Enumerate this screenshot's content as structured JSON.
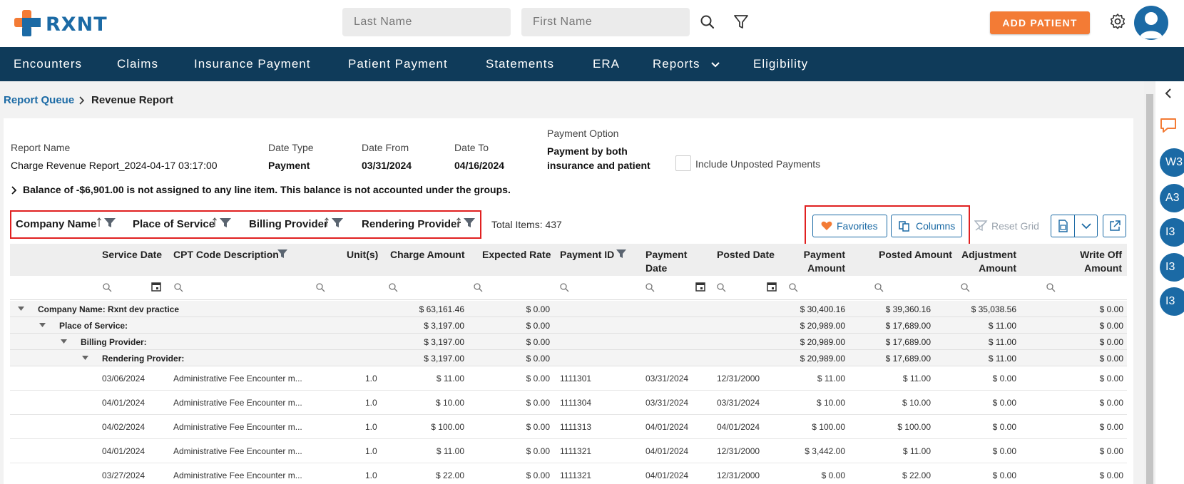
{
  "header": {
    "brand": "RXNT",
    "last_name_placeholder": "Last Name",
    "first_name_placeholder": "First Name",
    "add_patient_label": "ADD PATIENT"
  },
  "nav": {
    "items": [
      "Encounters",
      "Claims",
      "Insurance Payment",
      "Patient Payment",
      "Statements",
      "ERA",
      "Reports",
      "Eligibility"
    ]
  },
  "breadcrumb": {
    "parent": "Report Queue",
    "current": "Revenue Report"
  },
  "report": {
    "name_label": "Report Name",
    "name_value": "Charge Revenue Report_2024-04-17 03:17:00",
    "date_type_label": "Date Type",
    "date_type_value": "Payment",
    "date_from_label": "Date From",
    "date_from_value": "03/31/2024",
    "date_to_label": "Date To",
    "date_to_value": "04/16/2024",
    "payment_option_label": "Payment Option",
    "payment_option_value_line1": "Payment by both",
    "payment_option_value_line2": "insurance and patient",
    "include_unposted_label": "Include Unposted Payments",
    "balance_note": "Balance of -$6,901.00 is not assigned to any line item. This balance is not accounted under the groups."
  },
  "grouping": {
    "chips": [
      "Company Name",
      "Place of Service",
      "Billing Provider",
      "Rendering Provider"
    ],
    "total_items": "Total Items: 437"
  },
  "toolbar": {
    "favorites_label": "Favorites",
    "columns_label": "Columns",
    "reset_grid_label": "Reset Grid"
  },
  "table": {
    "headers": {
      "service_date": "Service Date",
      "cpt": "CPT Code Description",
      "units": "Unit(s)",
      "charge": "Charge Amount",
      "expected": "Expected Rate",
      "payment_id": "Payment ID",
      "payment_date_1": "Payment",
      "payment_date_2": "Date",
      "posted_date": "Posted Date",
      "payment_amount_1": "Payment",
      "payment_amount_2": "Amount",
      "posted_amount": "Posted Amount",
      "adjustment_1": "Adjustment",
      "adjustment_2": "Amount",
      "writeoff_1": "Write Off",
      "writeoff_2": "Amount"
    },
    "groups": [
      {
        "name": "Company Name: Rxnt dev practice",
        "charge": "$ 63,161.46",
        "expected": "$ 0.00",
        "payment": "$ 30,400.16",
        "posted": "$ 39,360.16",
        "adjustment": "$ 35,038.56",
        "writeoff": "$ 0.00"
      },
      {
        "name": "Place of Service:",
        "charge": "$ 3,197.00",
        "expected": "$ 0.00",
        "payment": "$ 20,989.00",
        "posted": "$ 17,689.00",
        "adjustment": "$ 11.00",
        "writeoff": "$ 0.00"
      },
      {
        "name": "Billing Provider:",
        "charge": "$ 3,197.00",
        "expected": "$ 0.00",
        "payment": "$ 20,989.00",
        "posted": "$ 17,689.00",
        "adjustment": "$ 11.00",
        "writeoff": "$ 0.00"
      },
      {
        "name": "Rendering Provider:",
        "charge": "$ 3,197.00",
        "expected": "$ 0.00",
        "payment": "$ 20,989.00",
        "posted": "$ 17,689.00",
        "adjustment": "$ 11.00",
        "writeoff": "$ 0.00"
      }
    ],
    "rows": [
      {
        "service_date": "03/06/2024",
        "cpt": "Administrative Fee Encounter m...",
        "units": "1.0",
        "charge": "$ 11.00",
        "expected": "$ 0.00",
        "payment_id": "1111301",
        "payment_date": "03/31/2024",
        "posted_date": "12/31/2000",
        "payment": "$ 11.00",
        "posted": "$ 11.00",
        "adjustment": "$ 0.00",
        "writeoff": "$ 0.00"
      },
      {
        "service_date": "04/01/2024",
        "cpt": "Administrative Fee Encounter m...",
        "units": "1.0",
        "charge": "$ 10.00",
        "expected": "$ 0.00",
        "payment_id": "1111304",
        "payment_date": "03/31/2024",
        "posted_date": "03/31/2024",
        "payment": "$ 10.00",
        "posted": "$ 10.00",
        "adjustment": "$ 0.00",
        "writeoff": "$ 0.00"
      },
      {
        "service_date": "04/02/2024",
        "cpt": "Administrative Fee Encounter m...",
        "units": "1.0",
        "charge": "$ 100.00",
        "expected": "$ 0.00",
        "payment_id": "1111313",
        "payment_date": "04/01/2024",
        "posted_date": "04/01/2024",
        "payment": "$ 100.00",
        "posted": "$ 100.00",
        "adjustment": "$ 0.00",
        "writeoff": "$ 0.00"
      },
      {
        "service_date": "04/01/2024",
        "cpt": "Administrative Fee Encounter m...",
        "units": "1.0",
        "charge": "$ 11.00",
        "expected": "$ 0.00",
        "payment_id": "1111321",
        "payment_date": "04/01/2024",
        "posted_date": "12/31/2000",
        "payment": "$ 3,442.00",
        "posted": "$ 11.00",
        "adjustment": "$ 0.00",
        "writeoff": "$ 0.00"
      },
      {
        "service_date": "03/27/2024",
        "cpt": "Administrative Fee Encounter m...",
        "units": "1.0",
        "charge": "$ 22.00",
        "expected": "$ 0.00",
        "payment_id": "1111321",
        "payment_date": "04/01/2024",
        "posted_date": "12/31/2000",
        "payment": "$ 0.00",
        "posted": "$ 22.00",
        "adjustment": "$ 0.00",
        "writeoff": "$ 0.00"
      }
    ]
  },
  "rail": {
    "bubbles": [
      "W3",
      "A3",
      "I3",
      "I3",
      "I3"
    ]
  },
  "colors": {
    "brand_blue": "#1b6aa5",
    "nav_bg": "#0f3b5a",
    "accent_orange": "#f37b35",
    "highlight_red": "#e02020"
  }
}
